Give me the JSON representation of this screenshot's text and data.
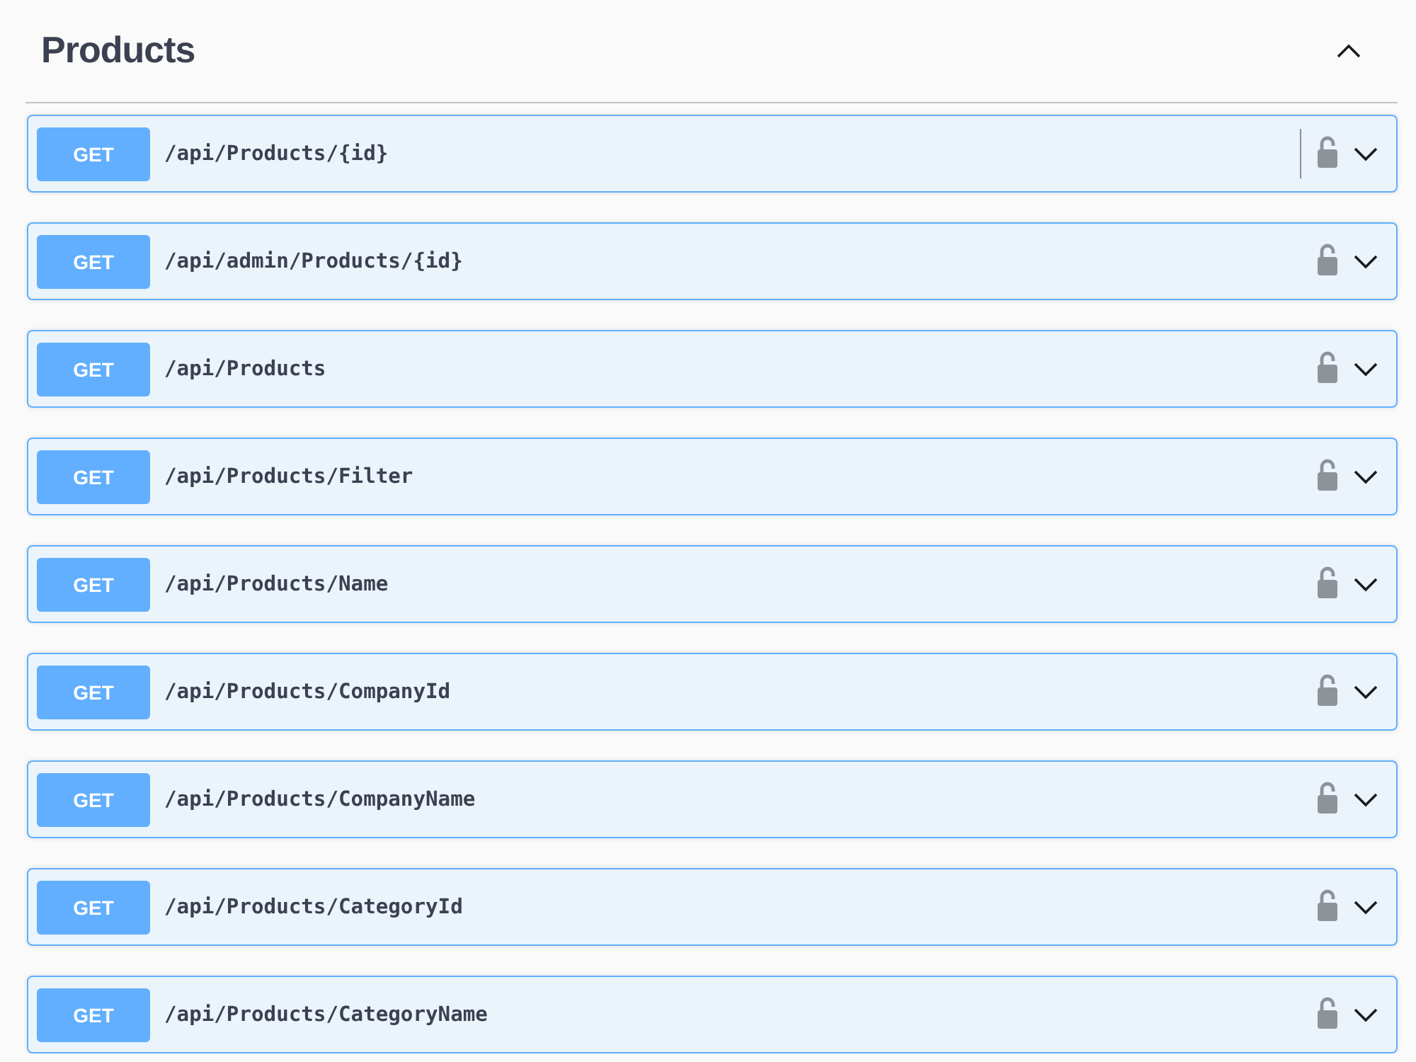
{
  "section": {
    "title": "Products",
    "expanded": true
  },
  "operations": [
    {
      "method": "GET",
      "path": "/api/Products/{id}",
      "hovered": true,
      "locked": false,
      "expanded": false
    },
    {
      "method": "GET",
      "path": "/api/admin/Products/{id}",
      "hovered": false,
      "locked": false,
      "expanded": false
    },
    {
      "method": "GET",
      "path": "/api/Products",
      "hovered": false,
      "locked": false,
      "expanded": false
    },
    {
      "method": "GET",
      "path": "/api/Products/Filter",
      "hovered": false,
      "locked": false,
      "expanded": false
    },
    {
      "method": "GET",
      "path": "/api/Products/Name",
      "hovered": false,
      "locked": false,
      "expanded": false
    },
    {
      "method": "GET",
      "path": "/api/Products/CompanyId",
      "hovered": false,
      "locked": false,
      "expanded": false
    },
    {
      "method": "GET",
      "path": "/api/Products/CompanyName",
      "hovered": false,
      "locked": false,
      "expanded": false
    },
    {
      "method": "GET",
      "path": "/api/Products/CategoryId",
      "hovered": false,
      "locked": false,
      "expanded": false
    },
    {
      "method": "GET",
      "path": "/api/Products/CategoryName",
      "hovered": false,
      "locked": false,
      "expanded": false
    }
  ]
}
